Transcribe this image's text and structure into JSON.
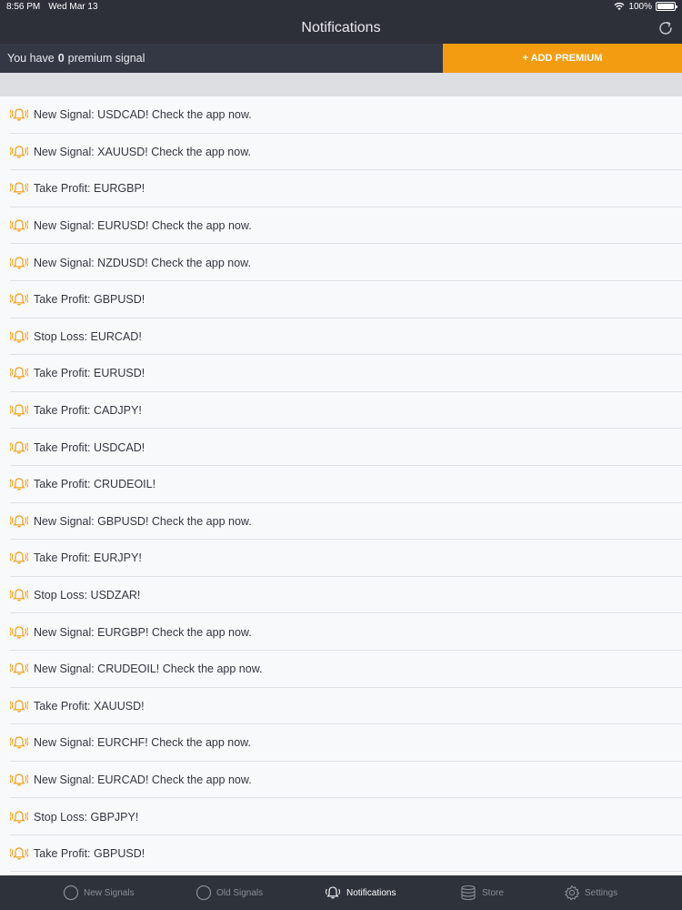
{
  "status_bar": {
    "time": "8:56 PM",
    "date": "Wed Mar 13",
    "battery": "100%"
  },
  "nav": {
    "title": "Notifications"
  },
  "premium": {
    "prefix": "You have",
    "count": "0",
    "suffix": "premium signal",
    "button_label": "+ ADD PREMIUM"
  },
  "notifications": [
    "New Signal: USDCAD! Check the app now.",
    "New Signal: XAUUSD! Check the app now.",
    "Take Profit: EURGBP!",
    "New Signal: EURUSD! Check the app now.",
    "New Signal: NZDUSD! Check the app now.",
    "Take Profit: GBPUSD!",
    "Stop Loss: EURCAD!",
    "Take Profit: EURUSD!",
    "Take Profit: CADJPY!",
    "Take Profit: USDCAD!",
    "Take Profit: CRUDEOIL!",
    "New Signal: GBPUSD! Check the app now.",
    "Take Profit: EURJPY!",
    "Stop Loss: USDZAR!",
    "New Signal: EURGBP! Check the app now.",
    "New Signal: CRUDEOIL! Check the app now.",
    "Take Profit: XAUUSD!",
    "New Signal: EURCHF! Check the app now.",
    "New Signal: EURCAD! Check the app now.",
    "Stop Loss: GBPJPY!",
    "Take Profit: GBPUSD!"
  ],
  "tabs": [
    {
      "label": "New Signals",
      "icon": "circle-icon",
      "active": false
    },
    {
      "label": "Old Signals",
      "icon": "circle-icon",
      "active": false
    },
    {
      "label": "Notifications",
      "icon": "bell-icon",
      "active": true
    },
    {
      "label": "Store",
      "icon": "coins-icon",
      "active": false
    },
    {
      "label": "Settings",
      "icon": "gear-icon",
      "active": false
    }
  ],
  "colors": {
    "accent": "#f39c12",
    "bar_background": "#2d3039",
    "list_background": "#f8f9fb"
  }
}
